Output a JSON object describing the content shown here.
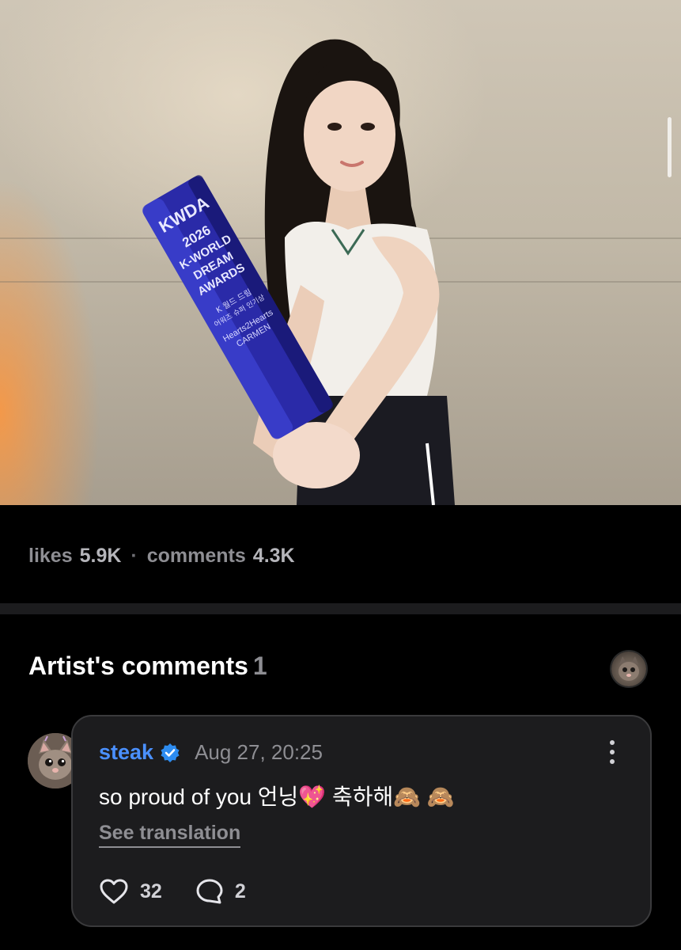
{
  "photo": {
    "trophy_lines": [
      "KWDA",
      "2026",
      "K-WORLD",
      "DREAM",
      "AWARDS",
      "K 월드 드림",
      "어워즈 슈퍼 인기상",
      "Hearts2Hearts",
      "CARMEN"
    ]
  },
  "stats": {
    "likes_label": "likes",
    "likes_value": "5.9K",
    "separator": "·",
    "comments_label": "comments",
    "comments_value": "4.3K"
  },
  "artist_comments": {
    "title": "Artist's comments",
    "count": "1",
    "header_avatar_icon": "cat-avatar-icon"
  },
  "comment": {
    "author": "steak",
    "verified_icon": "verified-badge-icon",
    "timestamp": "Aug 27, 20:25",
    "text": "so proud of you 언닝💖 축하해🙈 🙈",
    "see_translation": "See translation",
    "likes": "32",
    "replies": "2",
    "like_icon": "heart-icon",
    "reply_icon": "chat-bubble-icon",
    "more_icon": "more-vertical-icon"
  },
  "colors": {
    "background": "#000000",
    "card": "#1c1c1e",
    "author": "#4a90ff",
    "muted": "#8e8e93"
  }
}
